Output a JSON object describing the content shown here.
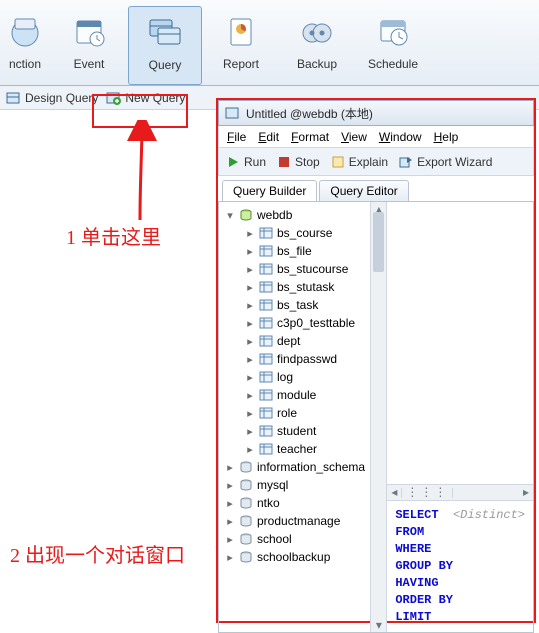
{
  "ribbon": {
    "items": [
      {
        "label": "nction",
        "icon": "function"
      },
      {
        "label": "Event",
        "icon": "event"
      },
      {
        "label": "Query",
        "icon": "query",
        "selected": true
      },
      {
        "label": "Report",
        "icon": "report"
      },
      {
        "label": "Backup",
        "icon": "backup"
      },
      {
        "label": "Schedule",
        "icon": "schedule"
      }
    ]
  },
  "secondbar": {
    "design": "Design Query",
    "new": "New Query"
  },
  "annotations": {
    "a1": "1 单击这里",
    "a2": "2 出现一个对话窗口"
  },
  "subwin": {
    "title": "Untitled @webdb (本地)",
    "menu": [
      "File",
      "Edit",
      "Format",
      "View",
      "Window",
      "Help"
    ],
    "toolbar": {
      "run": "Run",
      "stop": "Stop",
      "explain": "Explain",
      "export": "Export Wizard"
    },
    "tabs": {
      "builder": "Query Builder",
      "editor": "Query Editor"
    },
    "tree": {
      "root": "webdb",
      "tables": [
        "bs_course",
        "bs_file",
        "bs_stucourse",
        "bs_stutask",
        "bs_task",
        "c3p0_testtable",
        "dept",
        "findpasswd",
        "log",
        "module",
        "role",
        "student",
        "teacher"
      ],
      "other_dbs": [
        "information_schema",
        "mysql",
        "ntko",
        "productmanage",
        "school",
        "schoolbackup"
      ]
    },
    "sql": {
      "keywords": [
        "SELECT",
        "FROM",
        "WHERE",
        "GROUP BY",
        "HAVING",
        "ORDER BY",
        "LIMIT"
      ],
      "distinct": "<Distinct>"
    }
  }
}
